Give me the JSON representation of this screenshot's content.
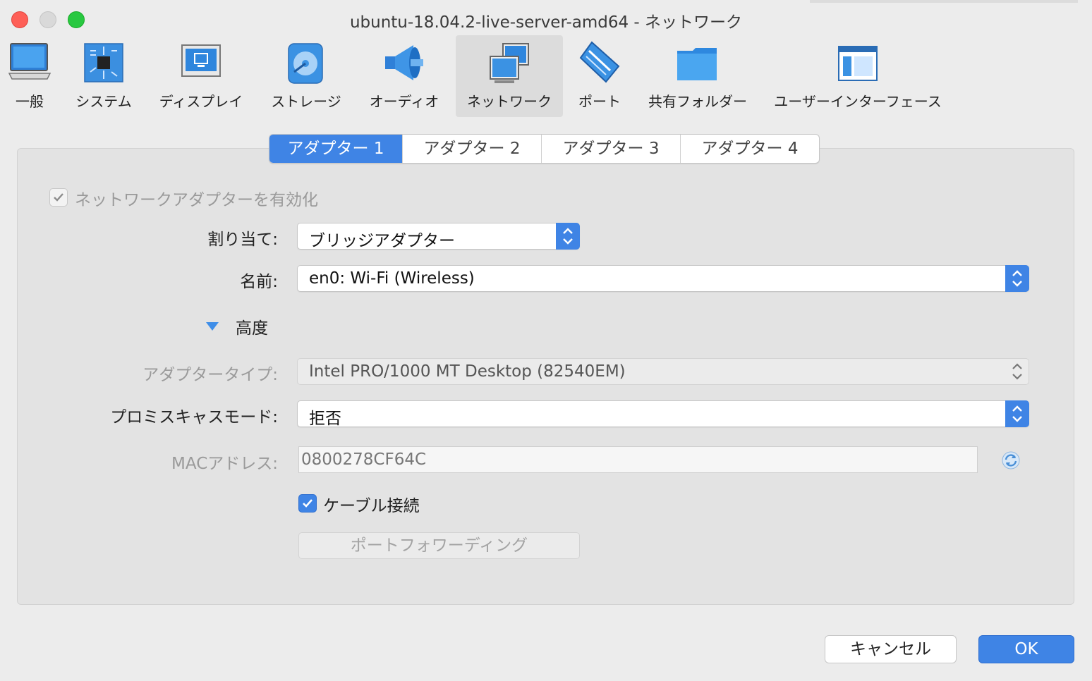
{
  "window": {
    "title": "ubuntu-18.04.2-live-server-amd64 - ネットワーク"
  },
  "toolbar": {
    "items": [
      {
        "label": "一般",
        "icon": "general-icon"
      },
      {
        "label": "システム",
        "icon": "system-chip-icon"
      },
      {
        "label": "ディスプレイ",
        "icon": "display-monitor-icon"
      },
      {
        "label": "ストレージ",
        "icon": "storage-disk-icon"
      },
      {
        "label": "オーディオ",
        "icon": "audio-speaker-icon"
      },
      {
        "label": "ネットワーク",
        "icon": "network-icon",
        "selected": true
      },
      {
        "label": "ポート",
        "icon": "port-connector-icon"
      },
      {
        "label": "共有フォルダー",
        "icon": "shared-folder-icon"
      },
      {
        "label": "ユーザーインターフェース",
        "icon": "user-interface-icon"
      }
    ]
  },
  "tabs": [
    {
      "label": "アダプター 1",
      "active": true
    },
    {
      "label": "アダプター 2"
    },
    {
      "label": "アダプター 3"
    },
    {
      "label": "アダプター 4"
    }
  ],
  "form": {
    "enable_adapter": {
      "label": "ネットワークアダプターを有効化",
      "checked": true,
      "disabled": true
    },
    "attached_to": {
      "label": "割り当て:",
      "value": "ブリッジアダプター"
    },
    "name": {
      "label": "名前:",
      "value": "en0: Wi-Fi (Wireless)"
    },
    "advanced": {
      "label": "高度",
      "expanded": true
    },
    "adapter_type": {
      "label": "アダプタータイプ:",
      "value": "Intel PRO/1000 MT Desktop (82540EM)"
    },
    "promiscuous_mode": {
      "label": "プロミスキャスモード:",
      "value": "拒否"
    },
    "mac_address": {
      "label": "MACアドレス:",
      "value": "0800278CF64C"
    },
    "cable_connected": {
      "label": "ケーブル接続",
      "checked": true
    },
    "port_forwarding": {
      "label": "ポートフォワーディング"
    }
  },
  "buttons": {
    "cancel": "キャンセル",
    "ok": "OK"
  },
  "colors": {
    "accent": "#3f84e5",
    "window_bg": "#ececec"
  }
}
